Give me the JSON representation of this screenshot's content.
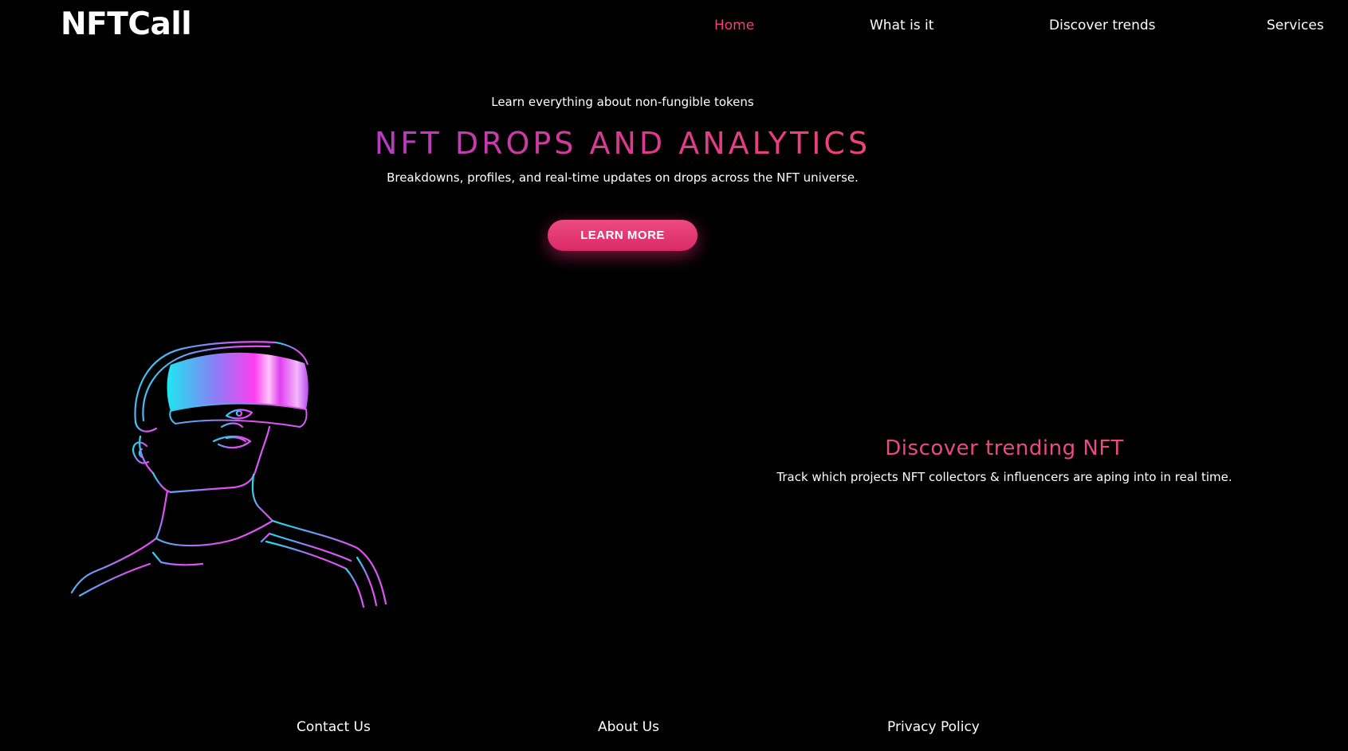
{
  "header": {
    "logo": "NFTCall",
    "nav": [
      {
        "label": "Home",
        "active": true
      },
      {
        "label": "What is it",
        "active": false
      },
      {
        "label": "Discover trends",
        "active": false
      },
      {
        "label": "Services",
        "active": false
      }
    ]
  },
  "hero": {
    "kicker": "Learn everything about non-fungible tokens",
    "title": "NFT DROPS AND ANALYTICS",
    "subtitle": "Breakdowns, profiles, and real-time updates on drops across the NFT universe.",
    "cta_label": "LEARN MORE"
  },
  "illustration": {
    "icon": "vr-headset-person-icon"
  },
  "discover": {
    "title": "Discover trending NFT",
    "subtitle": "Track which projects NFT collectors & influencers are aping into in real time."
  },
  "footer": {
    "links": [
      "Contact Us",
      "About Us",
      "Privacy Policy"
    ]
  },
  "colors": {
    "background": "#000000",
    "accent": "#ef3f7d",
    "text": "#ffffff",
    "gradient_cyan": "#19e4f0",
    "gradient_magenta": "#f23cf0"
  }
}
